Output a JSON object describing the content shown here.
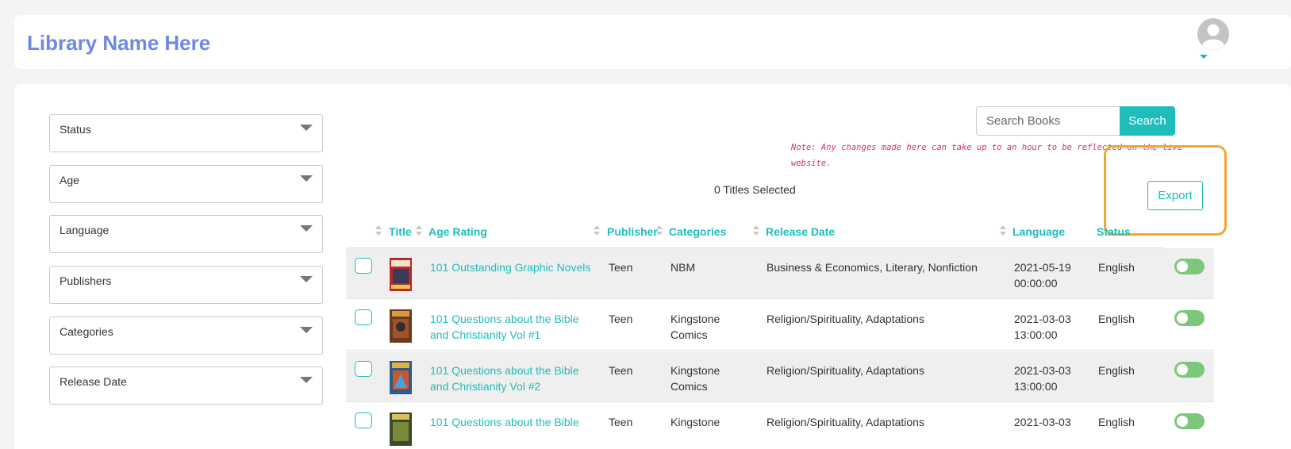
{
  "header": {
    "brand": "Library Name Here"
  },
  "filters": [
    {
      "label": "Status"
    },
    {
      "label": "Age"
    },
    {
      "label": "Language"
    },
    {
      "label": "Publishers"
    },
    {
      "label": "Categories"
    },
    {
      "label": "Release Date"
    }
  ],
  "search": {
    "placeholder": "Search Books",
    "button_label": "Search"
  },
  "note": "Note: Any changes made here can take up to an hour to be reflected on the live website.",
  "selected_count": "0 Titles Selected",
  "export_label": "Export",
  "table": {
    "columns": [
      "Title",
      "Age Rating",
      "Publisher",
      "Categories",
      "Release Date",
      "Language",
      "Status"
    ],
    "rows": [
      {
        "title": "101 Outstanding Graphic Novels",
        "age": "Teen",
        "publisher": "NBM",
        "categories": "Business & Economics, Literary, Nonfiction",
        "release_date": "2021-05-19 00:00:00",
        "language": "English"
      },
      {
        "title": "101 Questions about the Bible and Christianity Vol #1",
        "age": "Teen",
        "publisher": "Kingstone Comics",
        "categories": "Religion/Spirituality, Adaptations",
        "release_date": "2021-03-03 13:00:00",
        "language": "English"
      },
      {
        "title": "101 Questions about the Bible and Christianity Vol #2",
        "age": "Teen",
        "publisher": "Kingstone Comics",
        "categories": "Religion/Spirituality, Adaptations",
        "release_date": "2021-03-03 13:00:00",
        "language": "English"
      },
      {
        "title": "101 Questions about the Bible",
        "age": "Teen",
        "publisher": "Kingstone",
        "categories": "Religion/Spirituality, Adaptations",
        "release_date": "2021-03-03",
        "language": "English"
      }
    ]
  },
  "colors": {
    "accent": "#1fbcbc",
    "brand": "#6b8ae0",
    "highlight": "#f0a830",
    "toggle": "#7dc77a",
    "note": "#d6336c"
  }
}
